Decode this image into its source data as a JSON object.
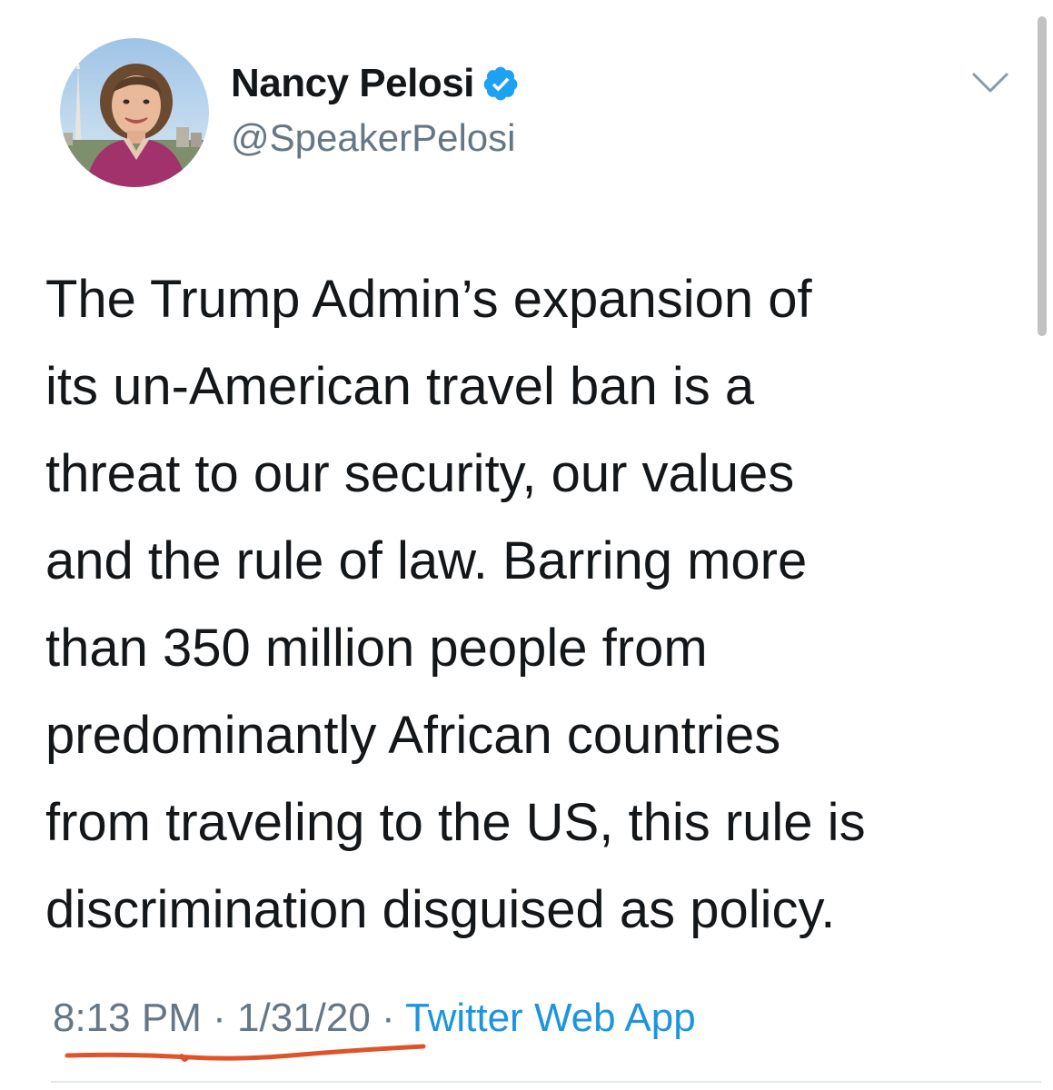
{
  "author": {
    "display_name": "Nancy Pelosi",
    "handle": "@SpeakerPelosi",
    "verified": true,
    "avatar_icon": "profile-photo"
  },
  "tweet": {
    "lines": [
      "The Trump Admin’s expansion of",
      "its un-American travel ban is a",
      "threat to our security, our values",
      "and the rule of law. Barring more",
      "than 350 million people from",
      "predominantly African countries",
      "from traveling to the US, this rule is",
      "discrimination disguised as policy."
    ]
  },
  "meta": {
    "time": "8:13 PM",
    "separator": "·",
    "date": "1/31/20",
    "source": "Twitter Web App"
  },
  "icons": {
    "verified": "verified-badge-icon",
    "more": "chevron-down-icon"
  },
  "colors": {
    "text": "#14171a",
    "secondary": "#657786",
    "link": "#1b95e0",
    "verified": "#1da1f2",
    "annotation_underline": "#e0532a"
  }
}
